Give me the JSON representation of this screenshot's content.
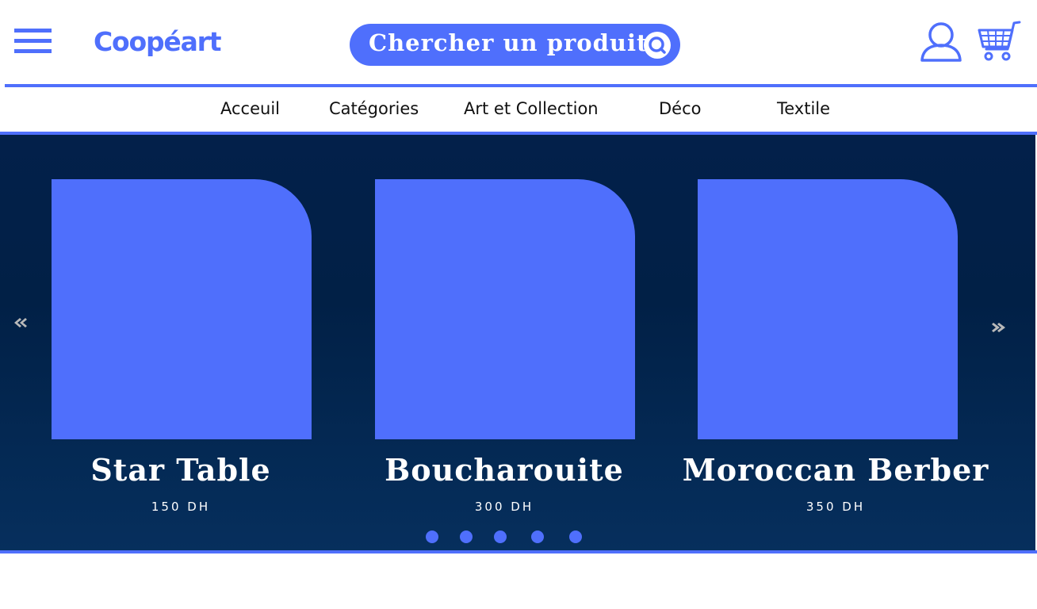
{
  "colors": {
    "accent": "#4f6ffc",
    "hero_background": "#02224b",
    "text_light": "#ffffff",
    "text_dark": "#111111",
    "arrow": "#b9b9b9"
  },
  "header": {
    "menu_icon": "hamburger-menu-icon",
    "logo": "Coopéart",
    "search": {
      "placeholder": "Chercher un produit",
      "icon": "search-icon"
    },
    "user_icon": "user-icon",
    "cart_icon": "shopping-cart-icon"
  },
  "nav": {
    "items": [
      {
        "label": "Acceuil"
      },
      {
        "label": "Catégories"
      },
      {
        "label": "Art et Collection"
      },
      {
        "label": "Déco"
      },
      {
        "label": "Textile"
      }
    ]
  },
  "carousel": {
    "prev_icon": "chevron-left-icon",
    "next_icon": "chevron-right-icon",
    "products": [
      {
        "name": "Star Table",
        "price": "150 DH"
      },
      {
        "name": "Boucharouite",
        "price": "300 DH"
      },
      {
        "name": "Moroccan Berber",
        "price": "350 DH"
      }
    ],
    "page_count": 5
  }
}
